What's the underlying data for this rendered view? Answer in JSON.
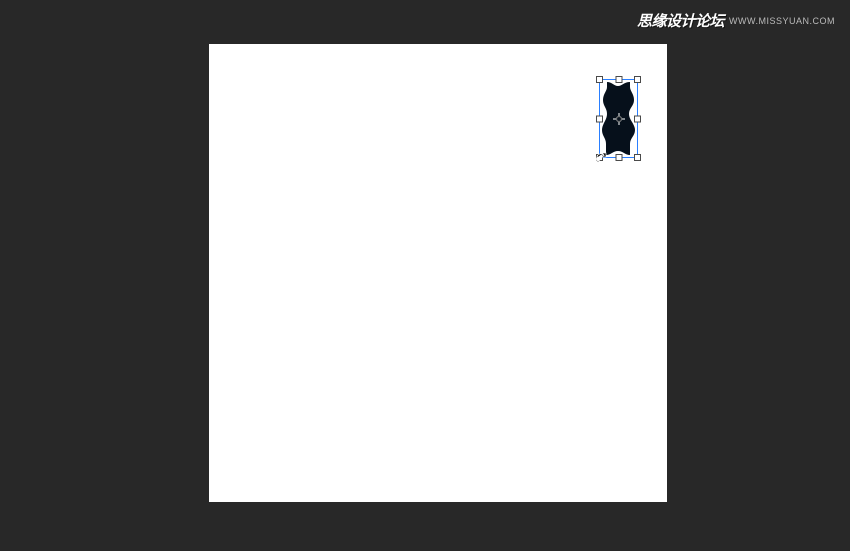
{
  "watermark": {
    "chinese": "思缘设计论坛",
    "url": "WWW.MISSYUAN.COM"
  },
  "canvas": {
    "background": "#ffffff"
  },
  "shape": {
    "fill": "#06101b"
  },
  "transform": {
    "frame_color": "#2a7fff",
    "handle_fill": "#ffffff",
    "handle_border": "#4a4a4a"
  }
}
